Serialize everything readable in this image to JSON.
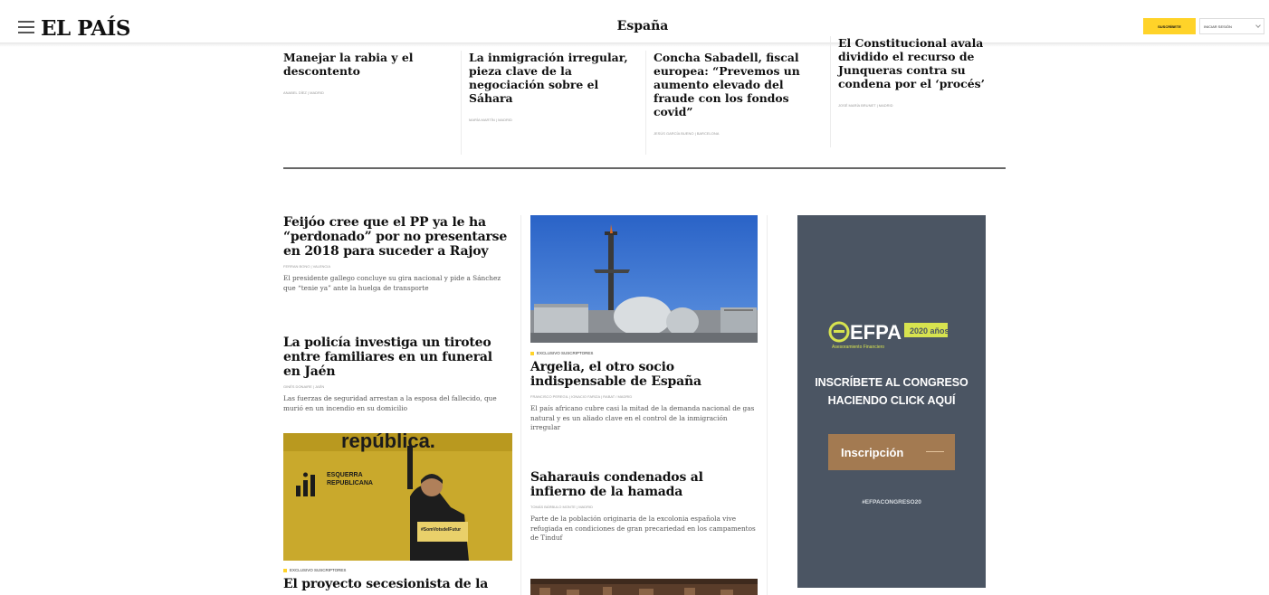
{
  "header": {
    "logo": "EL PAÍS",
    "section": "España",
    "subscribe_label": "SUSCRÍBETE",
    "login_label": "INICIAR SESIÓN"
  },
  "top_strip": [
    {
      "title": "Manejar la rabia y el descontento",
      "byline": "ANABEL DÍEZ | Madrid"
    },
    {
      "title": "La inmigración irregular, pieza clave de la negociación sobre el Sáhara",
      "byline": "MARÍA MARTÍN | Madrid"
    },
    {
      "title": "Concha Sabadell, fiscal europea: “Prevemos un aumento elevado del fraude con los fondos covid”",
      "byline": "JESÚS GARCÍA BUENO | Barcelona"
    },
    {
      "title": "El Constitucional avala dividido el recurso de Junqueras contra su condena por el ‘procés’",
      "byline": "JOSÉ MARÍA BRUNET | Madrid"
    }
  ],
  "left_column": {
    "article1": {
      "title": "Feijóo cree que el PP ya le ha “perdonado” por no presentarse en 2018 para suceder a Rajoy",
      "byline": "FERRAN BONO | Valencia",
      "summary": "El presidente gallego concluye su gira nacional y pide a Sánchez que “tenie ya” ante la huelga de transporte"
    },
    "article2": {
      "title": "La policía investiga un tiroteo entre familiares en un funeral en Jaén",
      "byline": "GINÉS DONAIRE | Jaén",
      "summary": "Las fuerzas de seguridad arrestan a la esposa del fallecido, que murió en un incendio en su domicilio"
    },
    "image_text": "república.",
    "image_banner": "ESQUERRA REPUBLICANA",
    "image_sign": "#SomVotsdelFutur",
    "article3": {
      "kicker": "EXCLUSIVO SUSCRIPTORES",
      "title": "El proyecto secesionista de la"
    }
  },
  "mid_column": {
    "article4": {
      "kicker": "EXCLUSIVO SUSCRIPTORES",
      "title": "Argelia, el otro socio indispensable de España",
      "byline": "FRANCISCO PEREGIL | IGNACIO FARIZA | Rabat / Madrid",
      "summary": "El país africano cubre casi la mitad de la demanda nacional de gas natural y es un aliado clave en el control de la inmigración irregular"
    },
    "article5": {
      "title": "Saharauis condenados al infierno de la hamada",
      "byline": "TOMÁS BÁRBULO MONTE | Madrid",
      "summary": "Parte de la población originaria de la excolonia española vive refugiada en condiciones de gran precariedad en los campamentos de Tinduf"
    }
  },
  "ad": {
    "logo_text": "EFPA",
    "logo_badge": "2020 años",
    "logo_sub": "Asesoramiento Financiero",
    "heading_line1": "INSCRÍBETE AL CONGRESO",
    "heading_line2": "HACIENDO CLICK AQUÍ",
    "button_label": "Inscripción",
    "hashtag": "#EFPACONGRESO20"
  },
  "colors": {
    "accent_yellow": "#ffd329",
    "ad_background": "#4b5563",
    "ad_button": "#a37a51"
  }
}
